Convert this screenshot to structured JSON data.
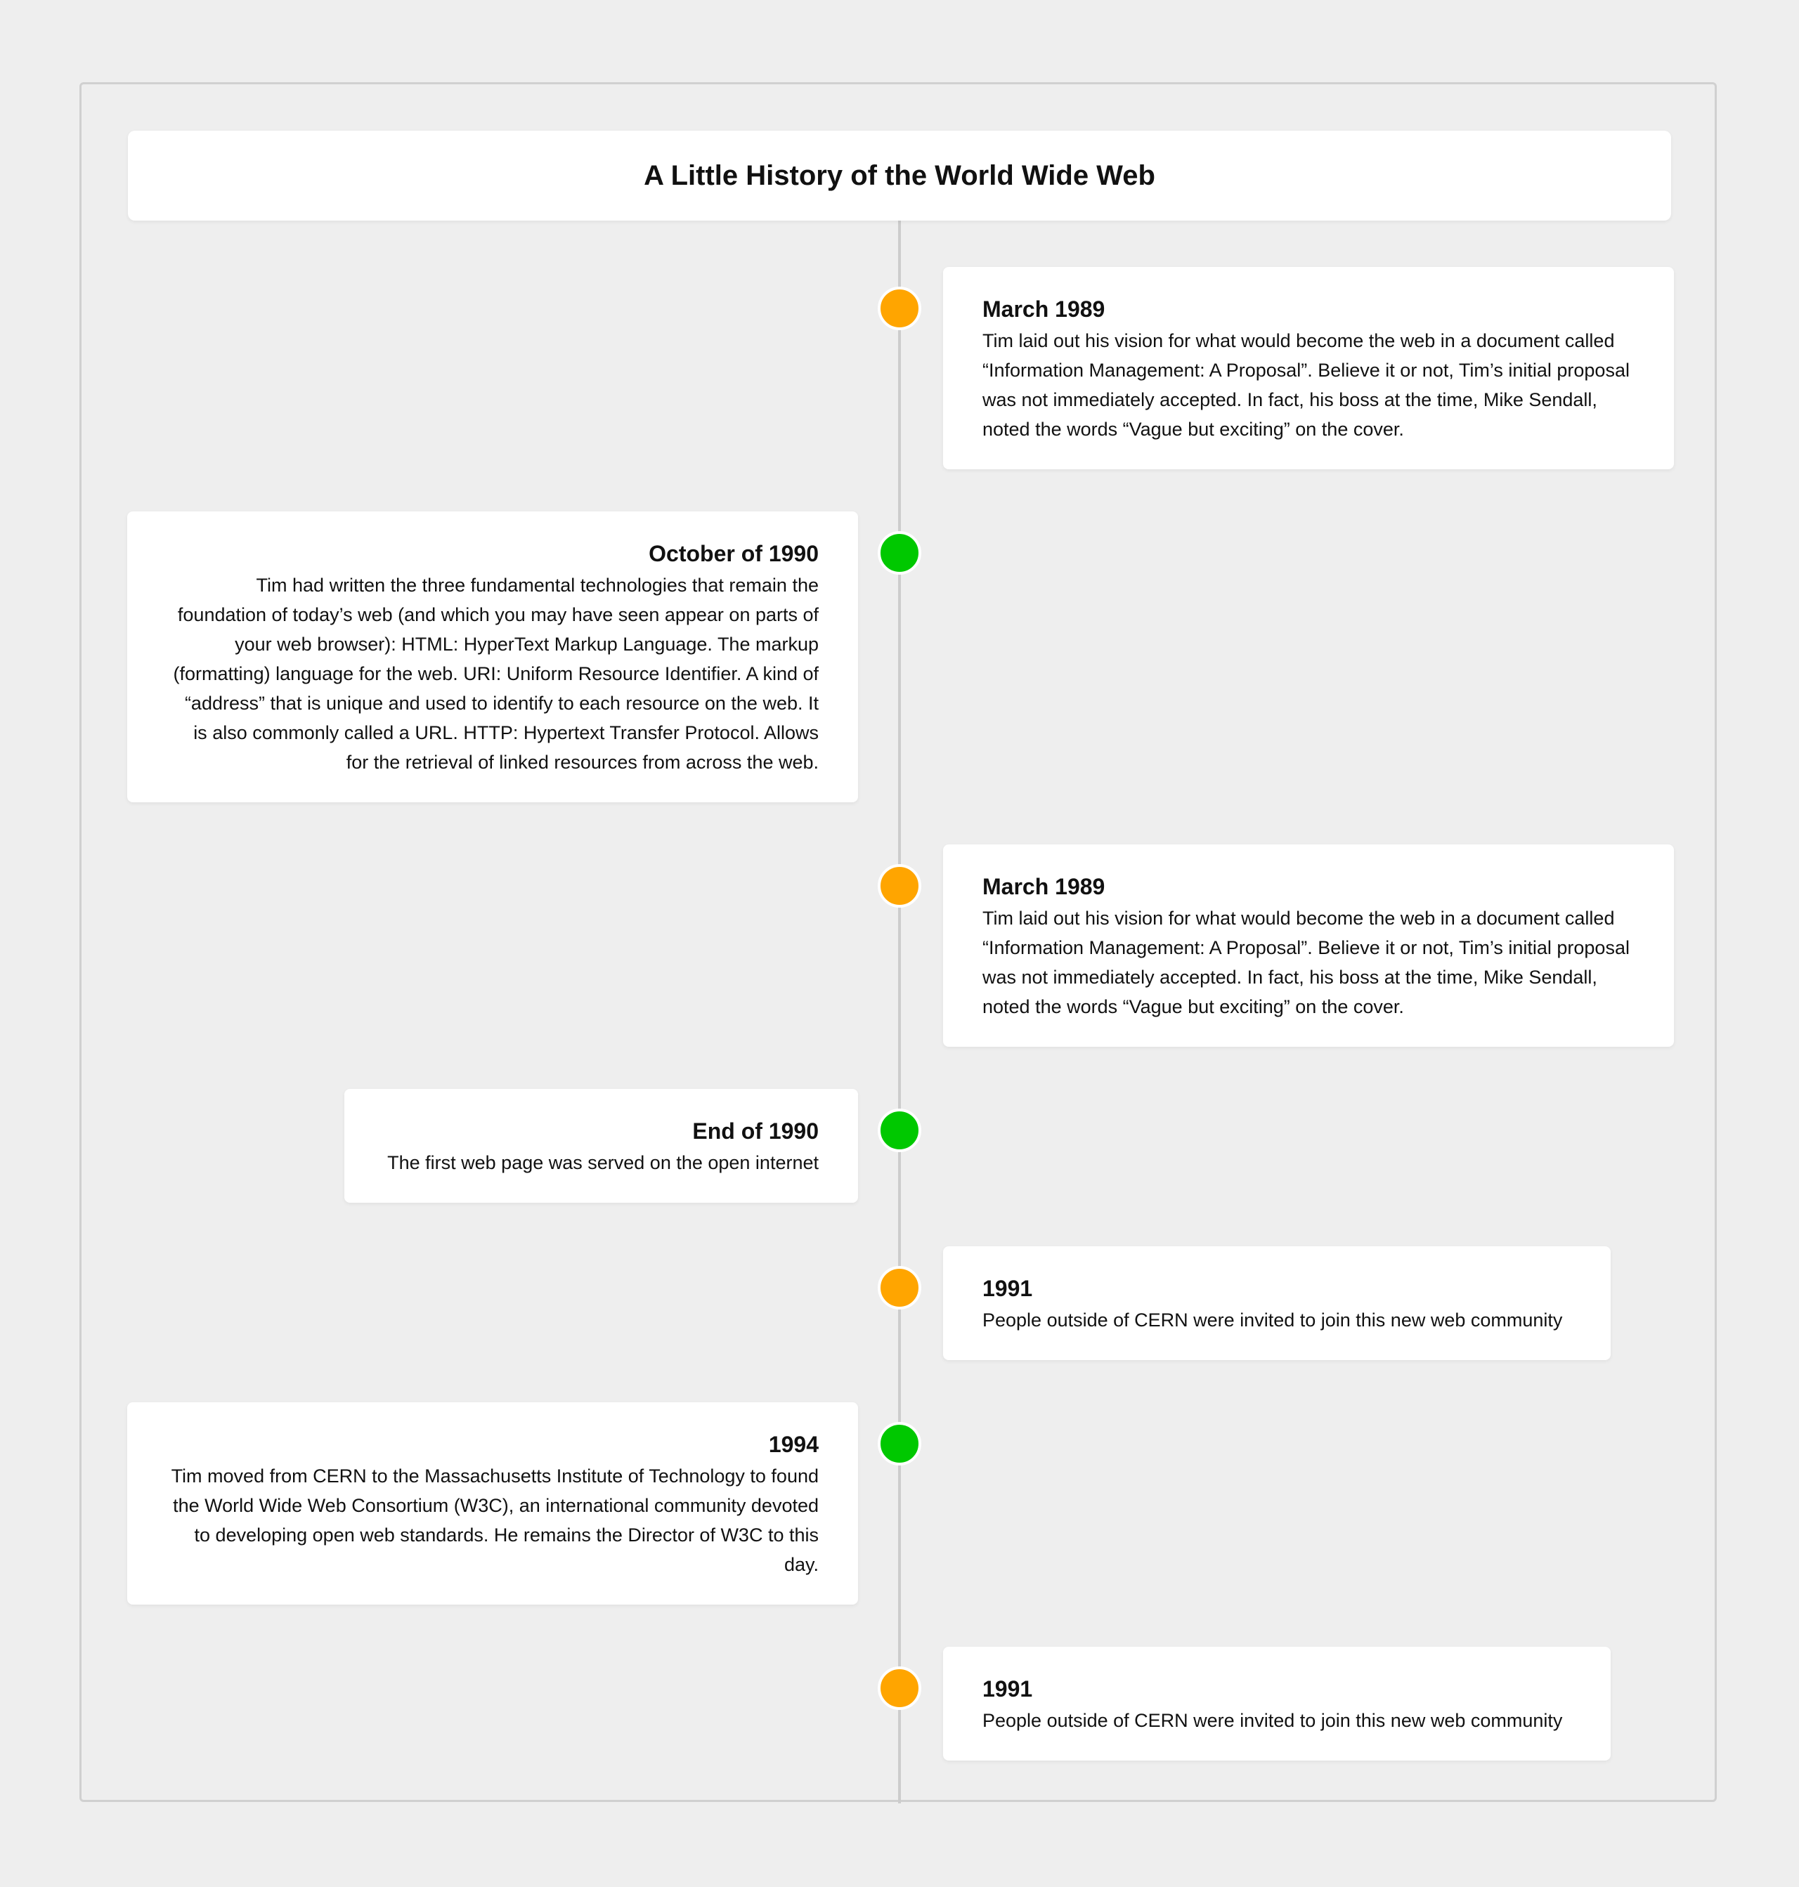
{
  "title": "A Little History of the World Wide Web",
  "colors": {
    "orange_dot": "#FFA500",
    "green_dot": "#00C800",
    "background": "#eeeeee",
    "spine": "#cccccc"
  },
  "events": [
    {
      "date": "March 1989",
      "text": "Tim laid out his vision for what would become the web in a document called “Information Management: A Proposal”. Believe it or not, Tim’s initial proposal was not immediately accepted. In fact, his boss at the time, Mike Sendall, noted the words “Vague but exciting” on the cover."
    },
    {
      "date": "October of 1990",
      "text": "Tim had written the three fundamental technologies that remain the foundation of today’s web (and which you may have seen appear on parts of your web browser): HTML: HyperText Markup Language. The markup (formatting) language for the web. URI: Uniform Resource Identifier. A kind of “address” that is unique and used to identify to each resource on the web. It is also commonly called a URL. HTTP: Hypertext Transfer Protocol. Allows for the retrieval of linked resources from across the web."
    },
    {
      "date": "March 1989",
      "text": "Tim laid out his vision for what would become the web in a document called “Information Management: A Proposal”. Believe it or not, Tim’s initial proposal was not immediately accepted. In fact, his boss at the time, Mike Sendall, noted the words “Vague but exciting” on the cover."
    },
    {
      "date": "End of 1990",
      "text": "The first web page was served on the open internet"
    },
    {
      "date": "1991",
      "text": "People outside of CERN were invited to join this new web community"
    },
    {
      "date": "1994",
      "text": "Tim moved from CERN to the Massachusetts Institute of Technology to found the World Wide Web Consortium (W3C), an international community devoted to developing open web standards. He remains the Director of W3C to this day."
    },
    {
      "date": "1991",
      "text": "People outside of CERN were invited to join this new web community"
    }
  ]
}
